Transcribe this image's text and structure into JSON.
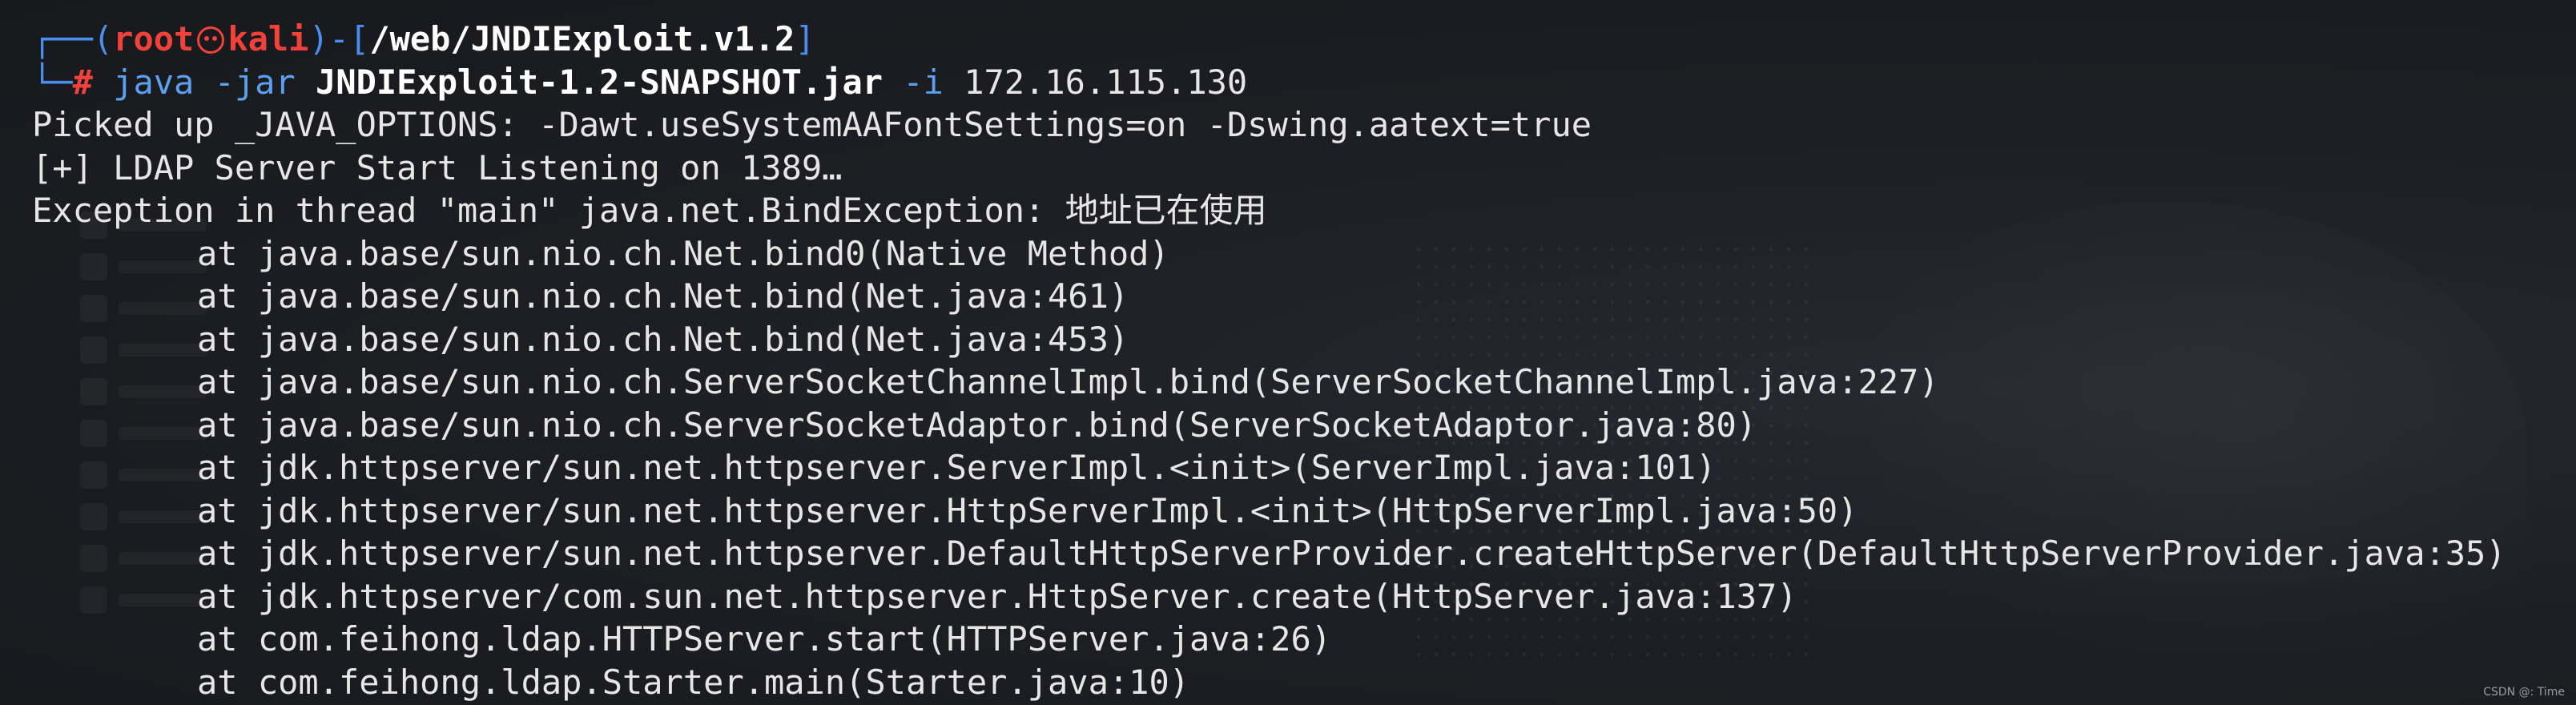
{
  "prompt": {
    "corner_top": "┌──(",
    "user": "root",
    "skull_icon": "skull-icon",
    "host": "kali",
    "sep": ")-[",
    "path": "/web/JNDIExploit.v1.2",
    "close": "]",
    "corner_bottom": "└─",
    "symbol": "# ",
    "command": "java",
    "arg1": " -jar",
    "jar": " JNDIExploit-1.2-SNAPSHOT.jar",
    "arg2": " -i",
    "ip": " 172.16.115.130"
  },
  "output": [
    "Picked up _JAVA_OPTIONS: -Dawt.useSystemAAFontSettings=on -Dswing.aatext=true",
    "[+] LDAP Server Start Listening on 1389…",
    "Exception in thread \"main\" java.net.BindException: 地址已在使用"
  ],
  "stack_trace": [
    "at java.base/sun.nio.ch.Net.bind0(Native Method)",
    "at java.base/sun.nio.ch.Net.bind(Net.java:461)",
    "at java.base/sun.nio.ch.Net.bind(Net.java:453)",
    "at java.base/sun.nio.ch.ServerSocketChannelImpl.bind(ServerSocketChannelImpl.java:227)",
    "at java.base/sun.nio.ch.ServerSocketAdaptor.bind(ServerSocketAdaptor.java:80)",
    "at jdk.httpserver/sun.net.httpserver.ServerImpl.<init>(ServerImpl.java:101)",
    "at jdk.httpserver/sun.net.httpserver.HttpServerImpl.<init>(HttpServerImpl.java:50)",
    "at jdk.httpserver/sun.net.httpserver.DefaultHttpServerProvider.createHttpServer(DefaultHttpServerProvider.java:35)",
    "at jdk.httpserver/com.sun.net.httpserver.HttpServer.create(HttpServer.java:137)",
    "at com.feihong.ldap.HTTPServer.start(HTTPServer.java:26)",
    "at com.feihong.ldap.Starter.main(Starter.java:10)"
  ],
  "watermark": "CSDN @: Time",
  "colors": {
    "background": "#1b1d22",
    "prompt_blue": "#4a8ef0",
    "prompt_red": "#f0413a",
    "text": "#e6e6e6"
  }
}
